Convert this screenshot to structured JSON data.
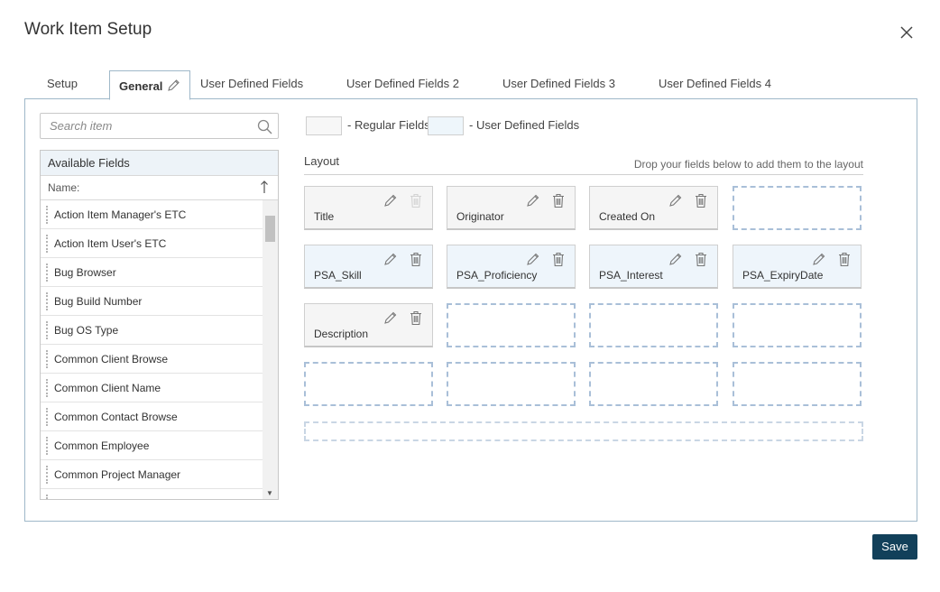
{
  "dialog": {
    "title": "Work Item Setup"
  },
  "tabs": [
    {
      "label": "Setup"
    },
    {
      "label": "General"
    },
    {
      "label": "User Defined Fields"
    },
    {
      "label": "User Defined Fields 2"
    },
    {
      "label": "User Defined Fields 3"
    },
    {
      "label": "User Defined Fields 4"
    }
  ],
  "search": {
    "placeholder": "Search item"
  },
  "available_fields": {
    "title": "Available Fields",
    "column": "Name:",
    "items": [
      "Action Item Manager's ETC",
      "Action Item User's ETC",
      "Bug Browser",
      "Bug Build Number",
      "Bug OS Type",
      "Common Client Browse",
      "Common Client Name",
      "Common Contact Browse",
      "Common Employee",
      "Common Project Manager"
    ]
  },
  "legend": {
    "regular": "- Regular Fields",
    "udf": "- User Defined Fields"
  },
  "layout": {
    "title": "Layout",
    "hint": "Drop your fields below to add them to the layout",
    "fields": [
      {
        "label": "Title",
        "type": "regular",
        "delete_enabled": false
      },
      {
        "label": "Originator",
        "type": "regular",
        "delete_enabled": true
      },
      {
        "label": "Created On",
        "type": "regular",
        "delete_enabled": true
      },
      {
        "label": "PSA_Skill",
        "type": "udf",
        "delete_enabled": true
      },
      {
        "label": "PSA_Proficiency",
        "type": "udf",
        "delete_enabled": true
      },
      {
        "label": "PSA_Interest",
        "type": "udf",
        "delete_enabled": true
      },
      {
        "label": "PSA_ExpiryDate",
        "type": "udf",
        "delete_enabled": true
      },
      {
        "label": "Description",
        "type": "regular",
        "delete_enabled": true
      }
    ]
  },
  "colors": {
    "accent": "#12405a",
    "tab_border": "#9fb8c9",
    "udf_bg": "#eef5fb",
    "slot_border": "#a9bfd8"
  },
  "footer": {
    "save_label": "Save"
  }
}
